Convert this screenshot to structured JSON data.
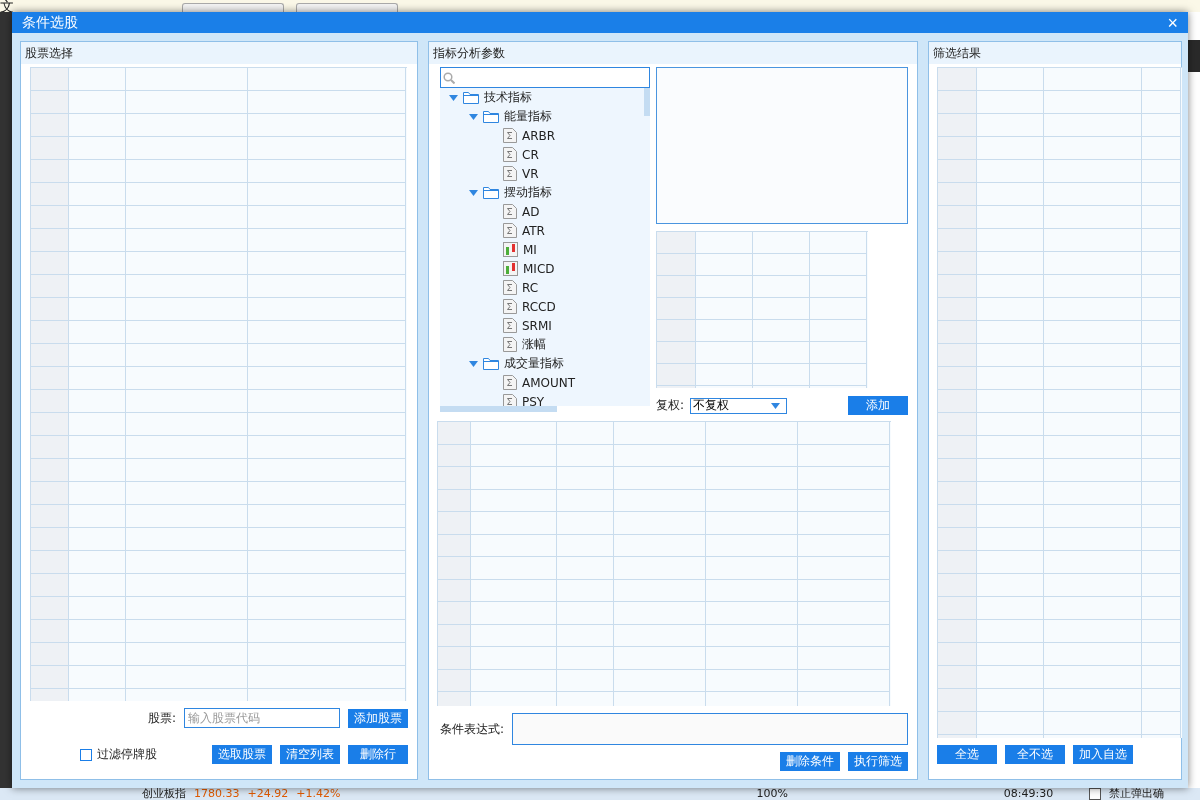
{
  "background": {
    "corner_text": "文",
    "status_bar": {
      "index_name": "创业板指",
      "index_value": "1780.33",
      "index_change": "+24.92",
      "index_percent": "+1.42%",
      "zoom": "100%",
      "time": "08:49:30",
      "confirm_checkbox": {
        "label": "禁止弹出确",
        "checked": false
      }
    }
  },
  "dialog": {
    "title": "条件选股",
    "close": "×",
    "stock_panel": {
      "title": "股票选择",
      "stock_label": "股票:",
      "stock_placeholder": "输入股票代码",
      "add_button": "添加股票",
      "filter_checkbox": {
        "label": "过滤停牌股",
        "checked": false
      },
      "buttons": [
        "选取股票",
        "清空列表",
        "删除行"
      ]
    },
    "indicator_panel": {
      "title": "指标分析参数",
      "tree": [
        {
          "label": "技术指标",
          "kind": "folder",
          "expanded": true,
          "children": [
            {
              "label": "能量指标",
              "kind": "folder",
              "expanded": true,
              "children": [
                {
                  "label": "ARBR",
                  "kind": "formula"
                },
                {
                  "label": "CR",
                  "kind": "formula"
                },
                {
                  "label": "VR",
                  "kind": "formula"
                }
              ]
            },
            {
              "label": "摆动指标",
              "kind": "folder",
              "expanded": true,
              "children": [
                {
                  "label": "AD",
                  "kind": "formula"
                },
                {
                  "label": "ATR",
                  "kind": "formula"
                },
                {
                  "label": "MI",
                  "kind": "candle"
                },
                {
                  "label": "MICD",
                  "kind": "candle"
                },
                {
                  "label": "RC",
                  "kind": "formula"
                },
                {
                  "label": "RCCD",
                  "kind": "formula"
                },
                {
                  "label": "SRMI",
                  "kind": "formula"
                },
                {
                  "label": "涨幅",
                  "kind": "formula"
                }
              ]
            },
            {
              "label": "成交量指标",
              "kind": "folder",
              "expanded": true,
              "children": [
                {
                  "label": "AMOUNT",
                  "kind": "formula"
                },
                {
                  "label": "PSY",
                  "kind": "formula"
                }
              ]
            }
          ]
        }
      ],
      "adjust_label": "复权:",
      "adjust_value": "不复权",
      "add_button": "添加",
      "expression_label": "条件表达式:",
      "buttons": [
        "删除条件",
        "执行筛选"
      ]
    },
    "result_panel": {
      "title": "筛选结果",
      "buttons": [
        "全选",
        "全不选",
        "加入自选"
      ]
    }
  }
}
